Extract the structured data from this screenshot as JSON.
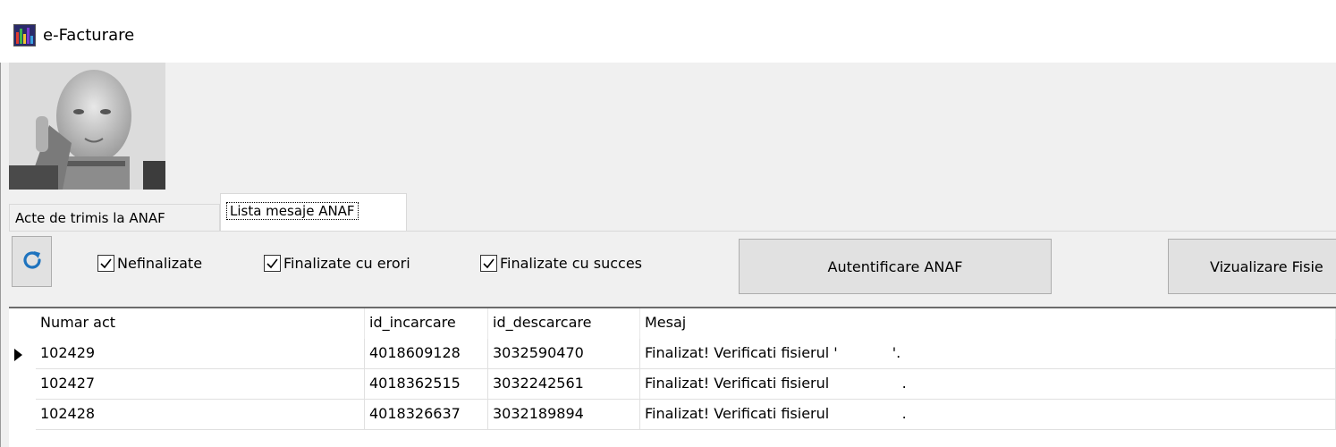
{
  "window": {
    "title": "e-Facturare",
    "app_icon": "bar-chart-app-icon"
  },
  "tabs": [
    {
      "label": "Acte de trimis la ANAF",
      "active": false
    },
    {
      "label": "Lista mesaje ANAF",
      "active": true
    }
  ],
  "toolbar": {
    "refresh_icon": "refresh-icon",
    "filters": [
      {
        "label": "Nefinalizate",
        "checked": true
      },
      {
        "label": "Finalizate cu erori",
        "checked": true
      },
      {
        "label": "Finalizate cu succes",
        "checked": true
      }
    ],
    "auth_button": "Autentificare ANAF",
    "view_button": "Vizualizare Fisie"
  },
  "grid": {
    "columns": [
      "Numar act",
      "id_incarcare",
      "id_descarcare",
      "Mesaj"
    ],
    "rows": [
      {
        "numar_act": "102429",
        "id_incarcare": "4018609128",
        "id_descarcare": "3032590470",
        "mesaj": "Finalizat! Verificati fisierul '            '.",
        "current": true
      },
      {
        "numar_act": "102427",
        "id_incarcare": "4018362515",
        "id_descarcare": "3032242561",
        "mesaj": "Finalizat! Verificati fisierul                .",
        "current": false
      },
      {
        "numar_act": "102428",
        "id_incarcare": "4018326637",
        "id_descarcare": "3032189894",
        "mesaj": "Finalizat! Verificati fisierul                .",
        "current": false
      }
    ]
  },
  "colors": {
    "panel": "#f0f0f0",
    "button": "#e1e1e1",
    "refresh_accent": "#1e73be"
  }
}
